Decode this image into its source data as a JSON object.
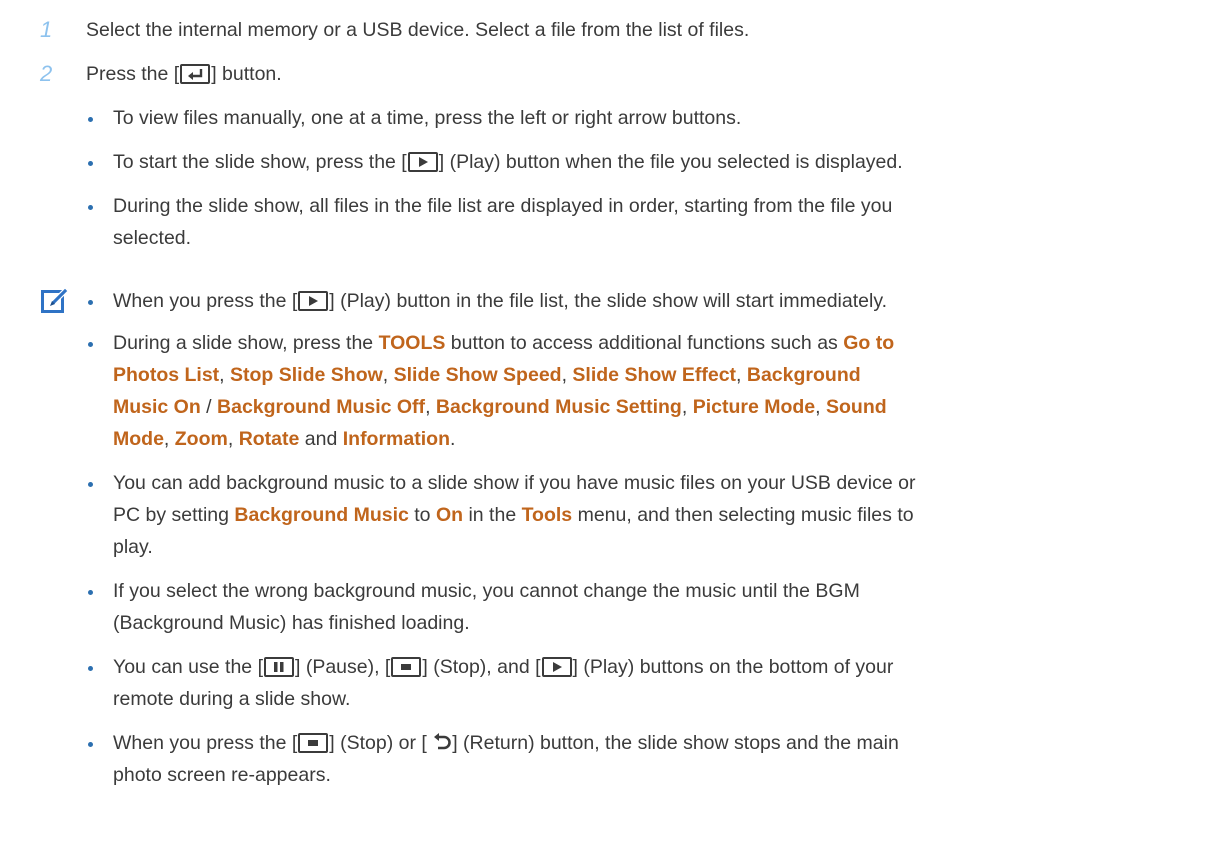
{
  "steps": [
    {
      "num": "1",
      "text": "Select the internal memory or a USB device. Select a file from the list of files."
    },
    {
      "num": "2",
      "text_before": "Press the [",
      "text_after": "] button."
    }
  ],
  "step2_bullets": {
    "b1": "To view files manually, one at a time, press the left or right arrow buttons.",
    "b2_before": "To start the slide show, press the [",
    "b2_after": "] (Play) button when the file you selected is displayed.",
    "b3_line1": "During the slide show, all files in the file list are displayed in order, starting from the file you",
    "b3_line2": "selected."
  },
  "notes": {
    "n1_before": "When you press the [",
    "n1_after": "] (Play) button in the file list, the slide show will start immediately.",
    "n2": {
      "l1_a": "During a slide show, press the ",
      "tools": "TOOLS",
      "l1_b": " button to access additional functions such as ",
      "goto1": "Go to",
      "goto2": "Photos List",
      "stop": "Stop Slide Show",
      "speed": "Slide Show Speed",
      "effect": "Slide Show Effect",
      "bgm_on1": "Background",
      "bgm_on2": "Music On",
      "slash": " / ",
      "bgm_off": "Background Music Off",
      "bgm_setting": "Background Music Setting",
      "picture": "Picture Mode",
      "sound1": "Sound",
      "sound2": "Mode",
      "zoom": "Zoom",
      "rotate": "Rotate",
      "and": " and ",
      "info": "Information",
      "comma": ", ",
      "period": "."
    },
    "n3": {
      "l1": "You can add background music to a slide show if you have music files on your USB device or",
      "l2_a": "PC by setting ",
      "bgm": "Background Music",
      "to": " to ",
      "on": "On",
      "in": " in the ",
      "tools": "Tools",
      "l2_b": " menu, and then selecting music files to",
      "l3": "play."
    },
    "n4_l1": "If you select the wrong background music, you cannot change the music until the BGM",
    "n4_l2": "(Background Music) has finished loading.",
    "n5": {
      "a": "You can use the [",
      "pause": "] (Pause), [",
      "stop": "] (Stop), and [",
      "play": "] (Play) buttons on the bottom of your",
      "l2": "remote during a slide show."
    },
    "n6": {
      "a": "When you press the [",
      "b": "] (Stop) or [ ",
      "c": "] (Return) button, the slide show stops and the main",
      "l2": "photo screen re-appears."
    }
  },
  "colors": {
    "highlight": "#c0651c",
    "step_number": "#8dc2ee",
    "bullet": "#2c6fb0",
    "text": "#3b3b3b"
  },
  "icons": [
    "enter-icon",
    "play-icon",
    "pause-icon",
    "stop-icon",
    "return-icon",
    "note-pencil-icon"
  ]
}
